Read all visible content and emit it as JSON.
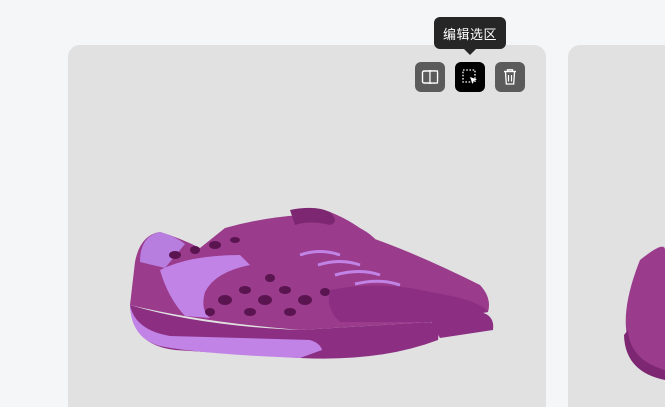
{
  "toolbar": {
    "tooltip_text": "编辑选区",
    "buttons": [
      {
        "name": "split-compare",
        "icon": "split-compare-icon"
      },
      {
        "name": "edit-selection",
        "icon": "selection-cursor-icon",
        "active": true
      },
      {
        "name": "delete",
        "icon": "trash-icon"
      }
    ]
  },
  "colors": {
    "background": "#f5f6f8",
    "card": "#e1e1e1",
    "button": "#5b5b5b",
    "button_active": "#000000",
    "tooltip": "#262626",
    "shoe_main": "#9a3b8c",
    "shoe_light": "#b77ee0"
  }
}
